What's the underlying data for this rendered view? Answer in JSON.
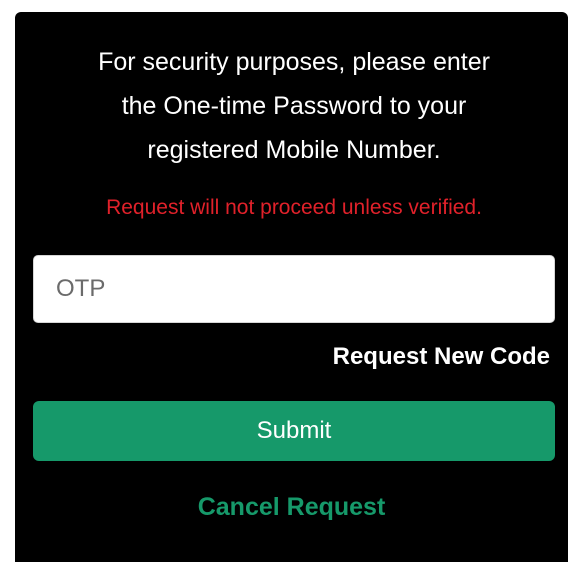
{
  "dialog": {
    "message_lines": [
      "For security purposes, please enter",
      "the One-time Password to your",
      "registered Mobile Number."
    ],
    "warning": "Request will not proceed unless verified.",
    "otp_field": {
      "value": "",
      "placeholder": "OTP"
    },
    "request_new_code_label": "Request New Code",
    "submit_label": "Submit",
    "cancel_label": "Cancel Request"
  },
  "colors": {
    "background": "#000000",
    "text": "#ffffff",
    "warning": "#e0212a",
    "accent": "#16996a"
  }
}
